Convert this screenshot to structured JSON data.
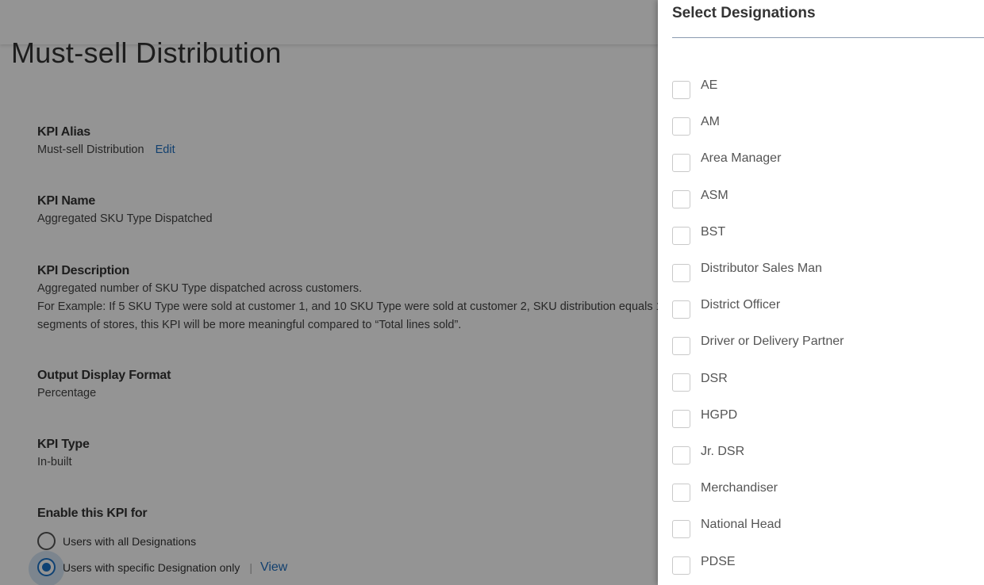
{
  "page": {
    "title": "Must-sell Distribution",
    "kpi_alias": {
      "label": "KPI Alias",
      "value": "Must-sell Distribution",
      "edit": "Edit"
    },
    "kpi_name": {
      "label": "KPI Name",
      "value": "Aggregated SKU Type Dispatched"
    },
    "kpi_description": {
      "label": "KPI Description",
      "lines": [
        "Aggregated number of SKU Type dispatched across customers.",
        "For Example: If 5 SKU Type were sold at customer 1, and 10 SKU Type were sold at customer 2, SKU distribution equals 1",
        "segments of stores, this KPI will be more meaningful compared to “Total lines sold”."
      ]
    },
    "output_format": {
      "label": "Output Display Format",
      "value": "Percentage"
    },
    "kpi_type": {
      "label": "KPI Type",
      "value": "In-built"
    },
    "enable_for": {
      "label": "Enable this KPI for",
      "option_all": "Users with all Designations",
      "option_specific": "Users with specific Designation only",
      "separator": "|",
      "view": "View",
      "selected": "specific"
    }
  },
  "drawer": {
    "title": "Select Designations",
    "options": [
      {
        "label": "AE",
        "checked": false
      },
      {
        "label": "AM",
        "checked": false
      },
      {
        "label": "Area Manager",
        "checked": false
      },
      {
        "label": "ASM",
        "checked": false
      },
      {
        "label": "BST",
        "checked": false
      },
      {
        "label": "Distributor Sales Man",
        "checked": false
      },
      {
        "label": "District Officer",
        "checked": false
      },
      {
        "label": "Driver or Delivery Partner",
        "checked": false
      },
      {
        "label": "DSR",
        "checked": false
      },
      {
        "label": "HGPD",
        "checked": false
      },
      {
        "label": "Jr. DSR",
        "checked": false
      },
      {
        "label": "Merchandiser",
        "checked": false
      },
      {
        "label": "National Head",
        "checked": false
      },
      {
        "label": "PDSE",
        "checked": false
      }
    ]
  },
  "colors": {
    "accent": "#1a73c8",
    "link": "#1f6fbf",
    "overlay": "rgba(0,0,0,0.42)"
  }
}
